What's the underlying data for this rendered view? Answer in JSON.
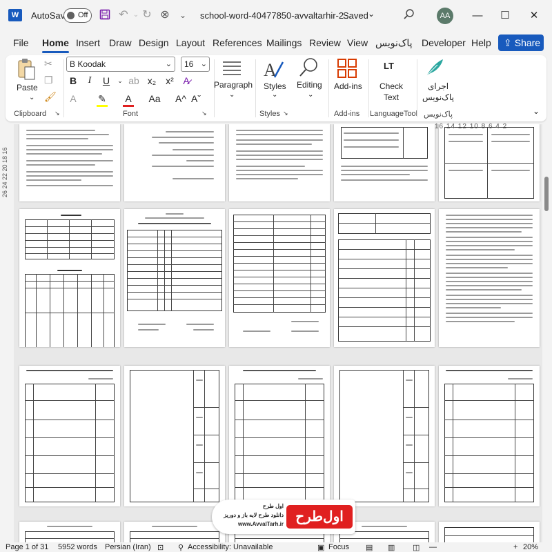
{
  "titlebar": {
    "app_letter": "W",
    "autosave_label": "AutoSave",
    "autosave_state": "Off",
    "doc_title": "school-word-40477850-avvaltarhir-2...",
    "save_status": "Saved",
    "avatar_initials": "AA"
  },
  "menu": {
    "items": [
      "File",
      "Home",
      "Insert",
      "Draw",
      "Design",
      "Layout",
      "References",
      "Mailings",
      "Review",
      "View",
      "پاک‌نویس",
      "Developer",
      "Help"
    ],
    "share_label": "Share"
  },
  "ribbon": {
    "clipboard": {
      "paste_label": "Paste",
      "group_label": "Clipboard"
    },
    "font": {
      "font_name": "B Koodak",
      "font_size": "16",
      "group_label": "Font",
      "bold": "B",
      "italic": "I",
      "underline": "U",
      "subscript": "x₂",
      "superscript": "x²",
      "case": "Aa",
      "grow": "A^",
      "shrink": "Aˇ"
    },
    "paragraph": {
      "label": "Paragraph"
    },
    "styles": {
      "label": "Styles",
      "group_label": "Styles"
    },
    "editing": {
      "label": "Editing"
    },
    "addins": {
      "label": "Add-ins",
      "group_label": "Add-ins"
    },
    "languagetool": {
      "label_line1": "Check",
      "label_line2": "Text",
      "group_label": "LanguageTool",
      "icon_text": "LT"
    },
    "paknevis": {
      "label_line1": "اجرای",
      "label_line2": "پاک‌نویس",
      "group_label": "پاک‌نویس"
    }
  },
  "rulers": {
    "horizontal": "16 14 12 10 8 6 4 2",
    "vertical": "26 24 22 20 18 16"
  },
  "statusbar": {
    "page": "Page 1 of 31",
    "words": "5952 words",
    "language": "Persian (Iran)",
    "accessibility": "Accessibility: Unavailable",
    "focus": "Focus",
    "zoom": "20%"
  },
  "watermark": {
    "line1": "اول طرح",
    "line2": "دانلود طرح لایه باز و دوریز",
    "line3": "www.AvvalTarh.ir",
    "logo": "اول‌طرح"
  },
  "colors": {
    "accent": "#185abd",
    "word_purple": "#7719aa",
    "logo_red": "#e02020"
  }
}
